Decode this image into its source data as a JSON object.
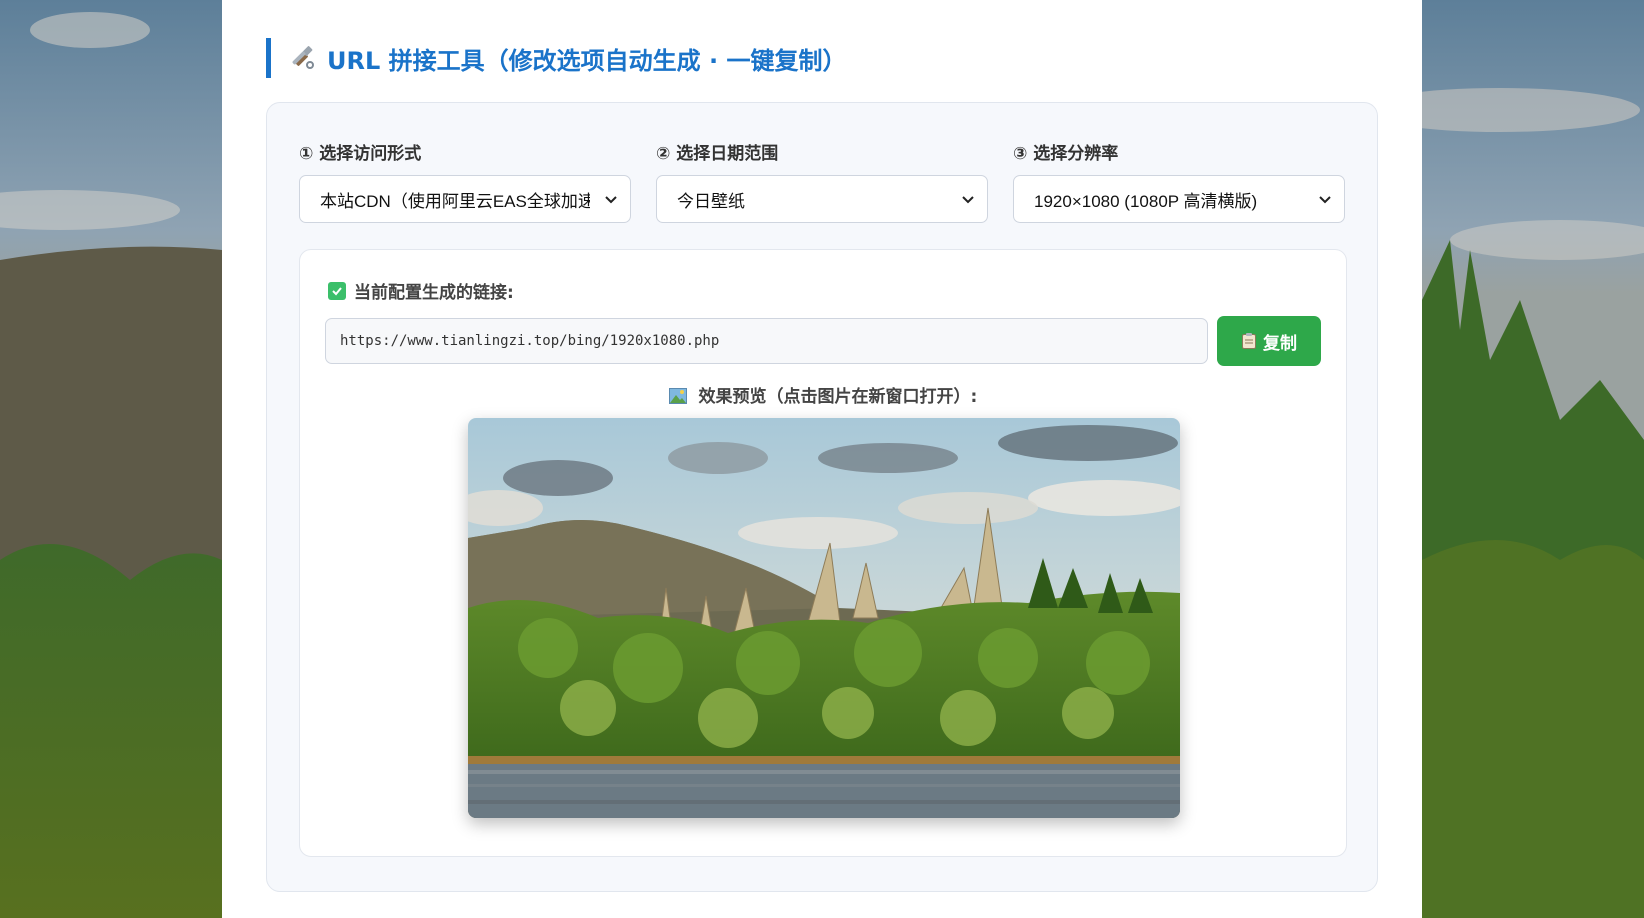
{
  "header": {
    "title": "URL 拼接工具（修改选项自动生成 · 一键复制）",
    "icon": "hammer-wrench-icon"
  },
  "selects": [
    {
      "label": "① 选择访问形式",
      "value": "本站CDN（使用阿里云EAS全球加速"
    },
    {
      "label": "② 选择日期范围",
      "value": "今日壁纸"
    },
    {
      "label": "③ 选择分辨率",
      "value": "1920×1080 (1080P 高清横版)"
    }
  ],
  "result": {
    "label": "当前配置生成的链接:",
    "url": "https://www.tianlingzi.top/bing/1920x1080.php",
    "copy_label": "复制",
    "preview_label": "效果预览（点击图片在新窗口打开）:"
  },
  "colors": {
    "accent": "#1a73c9",
    "copy_button": "#2ea84a",
    "check": "#3bbf6a"
  }
}
